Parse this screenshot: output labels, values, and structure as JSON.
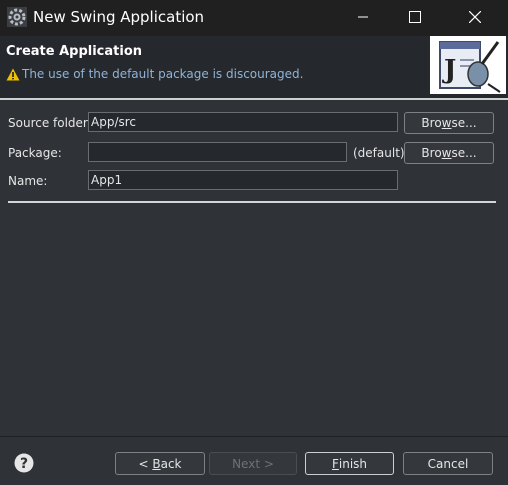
{
  "window": {
    "title": "New Swing Application",
    "icons": {
      "app": "eclipse-gear-icon",
      "minimize": "minimize-icon",
      "maximize": "maximize-icon",
      "close": "close-icon"
    }
  },
  "header": {
    "title": "Create Application",
    "message": "The use of the default package is discouraged.",
    "message_icon": "warning-icon",
    "wizard_image": "java-bean-wizard-image"
  },
  "form": {
    "source_folder": {
      "label": "Source folder:",
      "value": "App/src",
      "browse_pre": "Bro",
      "browse_mnemonic": "w",
      "browse_post": "se..."
    },
    "package": {
      "label": "Package:",
      "value": "",
      "note": "(default)",
      "browse_pre": "Bro",
      "browse_mnemonic": "w",
      "browse_post": "se..."
    },
    "name": {
      "label": "Name:",
      "value": "App1"
    }
  },
  "footer": {
    "help_icon": "help-icon",
    "back": {
      "prefix": "< ",
      "mnemonic": "B",
      "rest": "ack"
    },
    "next": "Next >",
    "finish": {
      "mnemonic": "F",
      "rest": "inish"
    },
    "cancel": "Cancel"
  },
  "colors": {
    "background": "#2f3236",
    "titlebar": "#202020",
    "header": "#25282c",
    "warning": "#f0c000",
    "message": "#8fb4d8"
  }
}
